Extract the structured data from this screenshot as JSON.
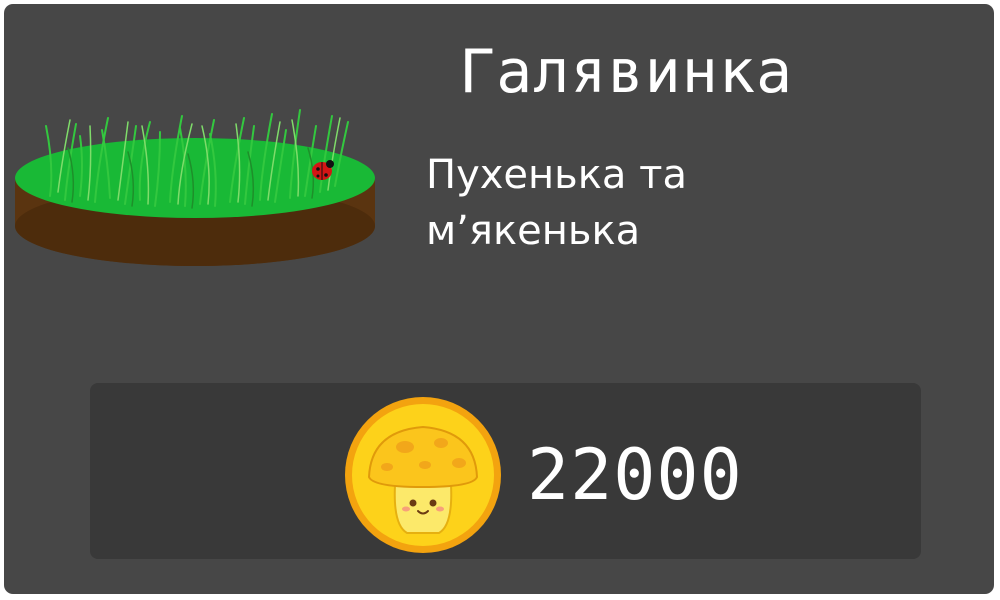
{
  "item": {
    "title": "Галявинка",
    "description_lines": [
      "Пухенька та",
      "м’якенька"
    ],
    "image_icon": "grass-patch-with-ladybug-icon"
  },
  "price": {
    "currency_icon": "mushroom-coin-icon",
    "amount": "22000"
  },
  "colors": {
    "card_background": "#474747",
    "price_panel_background": "#393939",
    "text": "#ffffff",
    "grass": "#19b936",
    "soil": "#5a3410",
    "coin": "#fdd21a"
  }
}
